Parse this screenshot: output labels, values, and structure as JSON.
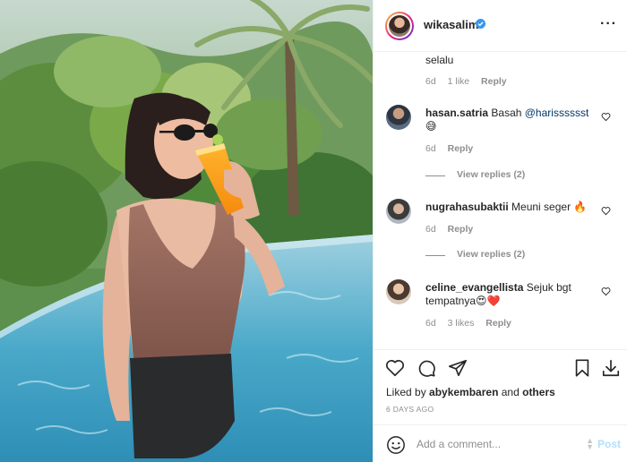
{
  "post": {
    "username": "wikasalim",
    "verified": true,
    "more_icon": "more-horizontal-icon"
  },
  "comments": [
    {
      "text": "selalu",
      "time": "6d",
      "likes": "1 like",
      "reply": "Reply"
    },
    {
      "user": "hasan.satria",
      "text": "Basah ",
      "mention": "@harisssssst",
      "emoji": "😅",
      "time": "6d",
      "reply": "Reply",
      "view_replies": "View replies (2)"
    },
    {
      "user": "nugrahasubaktii",
      "text": "Meuni seger ",
      "emoji": "🔥",
      "time": "6d",
      "reply": "Reply",
      "view_replies": "View replies (2)"
    },
    {
      "user": "celine_evangellista",
      "text": "Sejuk bgt tempatnya",
      "emoji": "😍❤️",
      "time": "6d",
      "likes": "3 likes",
      "reply": "Reply"
    }
  ],
  "likes": {
    "prefix": "Liked by ",
    "user": "abykembaren",
    "middle": " and ",
    "others": "others"
  },
  "timestamp": "6 DAYS AGO",
  "add_comment": {
    "placeholder": "Add a comment...",
    "post_label": "Post"
  },
  "colors": {
    "verified_blue": "#3897f0",
    "post_disabled": "#b2dffc",
    "mention": "#00376b"
  }
}
